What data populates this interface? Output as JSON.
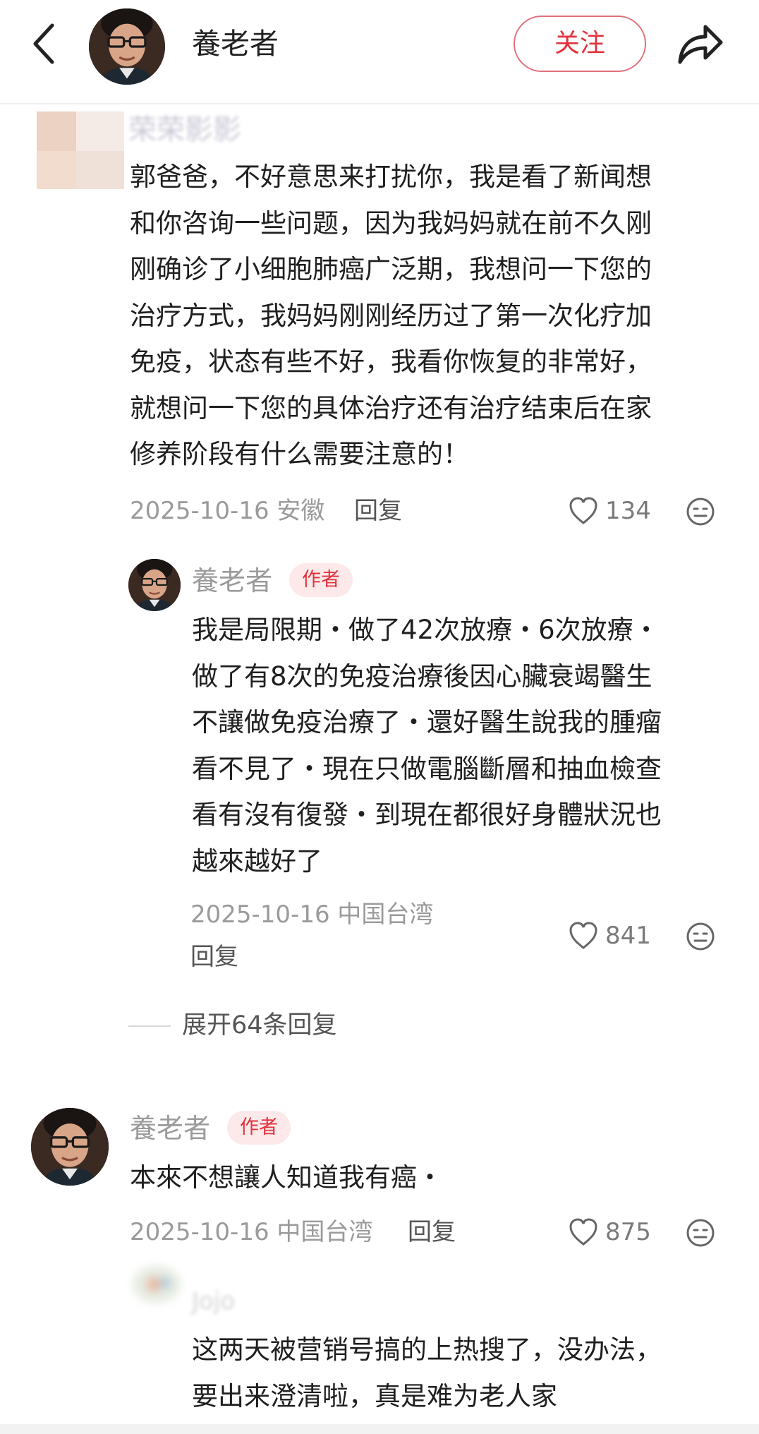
{
  "header": {
    "title": "養老者",
    "follow_label": "关注"
  },
  "comments": [
    {
      "username": "荣荣影影",
      "lines": [
        "郭爸爸，不好意思来打扰你，我是看了新闻想",
        "和你咨询一些问题，因为我妈妈就在前不久刚",
        "刚确诊了小细胞肺癌广泛期，我想问一下您的",
        "治疗方式，我妈妈刚刚经历过了第一次化疗加",
        "免疫，状态有些不好，我看你恢复的非常好，",
        "就想问一下您的具体治疗还有治疗结束后在家",
        "修养阶段有什么需要注意的！"
      ],
      "date_location": "2025-10-16 安徽",
      "reply_label": "回复",
      "likes": "134",
      "reply": {
        "username": "養老者",
        "badge": "作者",
        "lines": [
          "我是局限期・做了42次放療・6次放療・",
          "做了有8次的免疫治療後因心臟衰竭醫生",
          "不讓做免疫治療了・還好醫生說我的腫瘤",
          "看不見了・現在只做電腦斷層和抽血檢查",
          "看有沒有復發・到現在都很好身體狀況也",
          "越來越好了"
        ],
        "date_location": "2025-10-16 中国台湾",
        "reply_label": "回复",
        "likes": "841"
      },
      "expand_label": "展开64条回复"
    },
    {
      "username": "養老者",
      "badge": "作者",
      "text": "本來不想讓人知道我有癌・",
      "date_location": "2025-10-16 中国台湾",
      "reply_label": "回复",
      "likes": "875",
      "reply": {
        "username": "Jojo",
        "lines": [
          "这两天被营销号搞的上热搜了，没办法，",
          "要出来澄清啦，真是难为老人家"
        ]
      }
    }
  ],
  "colors": {
    "accent_red": "#e2323d",
    "badge_bg": "#fde9ea",
    "meta_gray": "#9a9a9a"
  },
  "icons": [
    "back-arrow-icon",
    "share-icon",
    "heart-icon",
    "neutral-face-icon"
  ]
}
